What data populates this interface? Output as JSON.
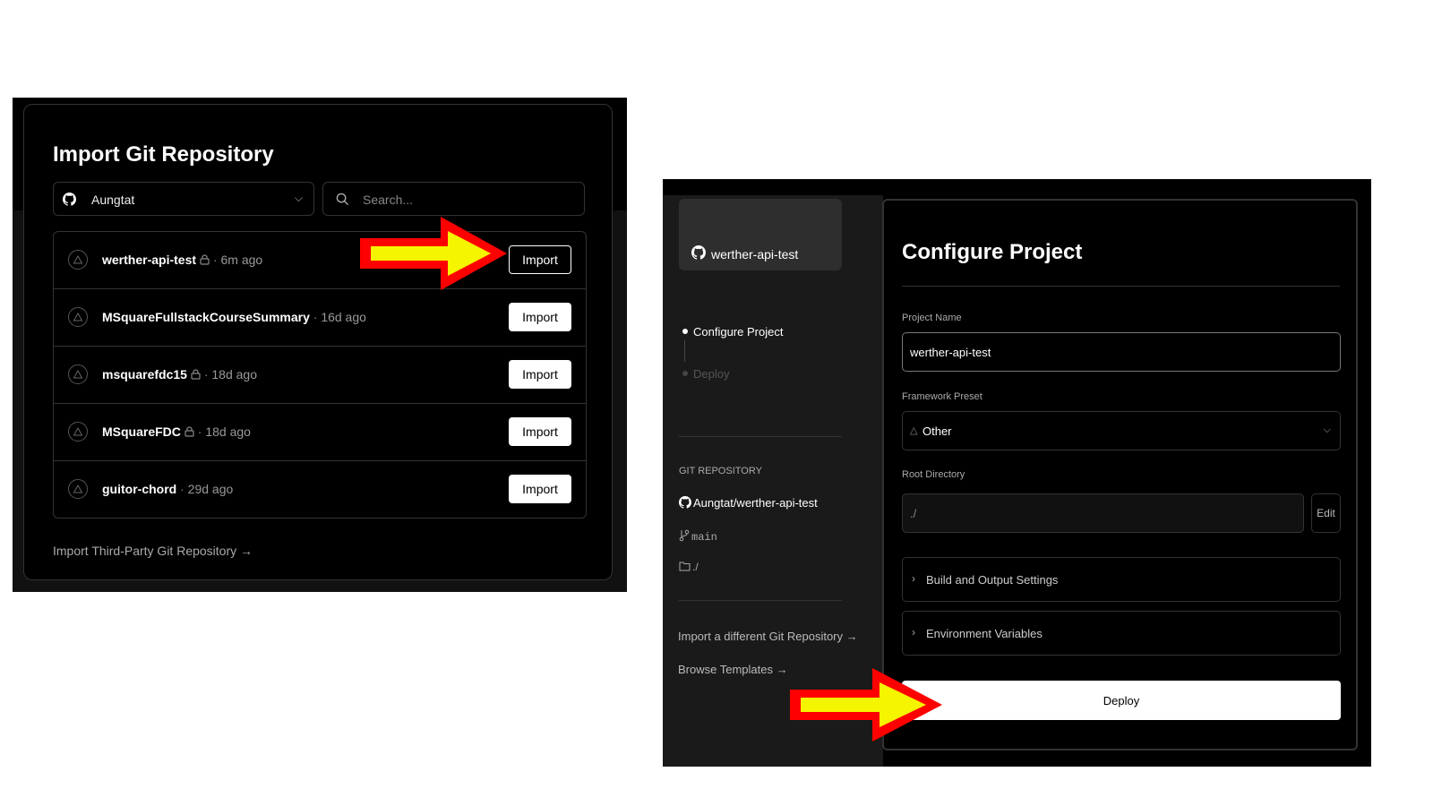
{
  "left_panel": {
    "title": "Import Git Repository",
    "owner_select": {
      "value": "Aungtat"
    },
    "search": {
      "placeholder": "Search..."
    },
    "repos": [
      {
        "name": "werther-api-test",
        "private": true,
        "sep": " · ",
        "age": "6m ago",
        "import_label": "Import",
        "highlighted": true
      },
      {
        "name": "MSquareFullstackCourseSummary",
        "private": false,
        "sep": " · ",
        "age": "16d ago",
        "import_label": "Import",
        "highlighted": false
      },
      {
        "name": "msquarefdc15",
        "private": true,
        "sep": " · ",
        "age": "18d ago",
        "import_label": "Import",
        "highlighted": false
      },
      {
        "name": "MSquareFDC",
        "private": true,
        "sep": " · ",
        "age": "18d ago",
        "import_label": "Import",
        "highlighted": false
      },
      {
        "name": "guitor-chord",
        "private": false,
        "sep": " · ",
        "age": "29d ago",
        "import_label": "Import",
        "highlighted": false
      }
    ],
    "third_party_link": "Import Third-Party Git Repository →"
  },
  "right_panel": {
    "repo_card_name": "werther-api-test",
    "steps": {
      "configure": "Configure Project",
      "deploy": "Deploy"
    },
    "git_repository": {
      "label": "GIT REPOSITORY",
      "full_name": "Aungtat/werther-api-test",
      "branch": "main",
      "directory": "./"
    },
    "links": {
      "import_different": "Import a different Git Repository →",
      "browse_templates": "Browse Templates →"
    },
    "configure": {
      "title": "Configure Project",
      "project_name_label": "Project Name",
      "project_name_value": "werther-api-test",
      "framework_label": "Framework Preset",
      "framework_value": "Other",
      "root_dir_label": "Root Directory",
      "root_dir_value": "./",
      "edit_label": "Edit",
      "build_settings_label": "Build and Output Settings",
      "env_vars_label": "Environment Variables",
      "deploy_label": "Deploy"
    }
  },
  "colors": {
    "arrow_fill": "#f5f500",
    "arrow_outline": "#ff0000",
    "panel_bg": "#000000",
    "border": "#333333"
  }
}
